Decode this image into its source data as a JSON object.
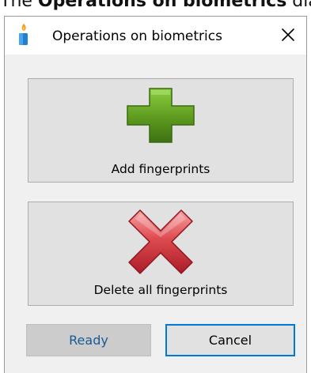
{
  "top_snippet": {
    "prefix": "The ",
    "bold": "Operations on biometrics",
    "suffix": " dialo"
  },
  "window": {
    "title": "Operations on biometrics",
    "app_icon": "candle-icon",
    "close_icon": "close-icon"
  },
  "actions": {
    "add_label": "Add fingerprints",
    "add_icon": "green-plus-icon",
    "delete_label": "Delete all fingerprints",
    "delete_icon": "red-x-icon"
  },
  "footer": {
    "ready_label": "Ready",
    "cancel_label": "Cancel"
  },
  "colors": {
    "accent": "#0078d7",
    "plus": "#5d9a1f",
    "cross": "#cc2b36",
    "ready_text": "#1a5a96"
  }
}
